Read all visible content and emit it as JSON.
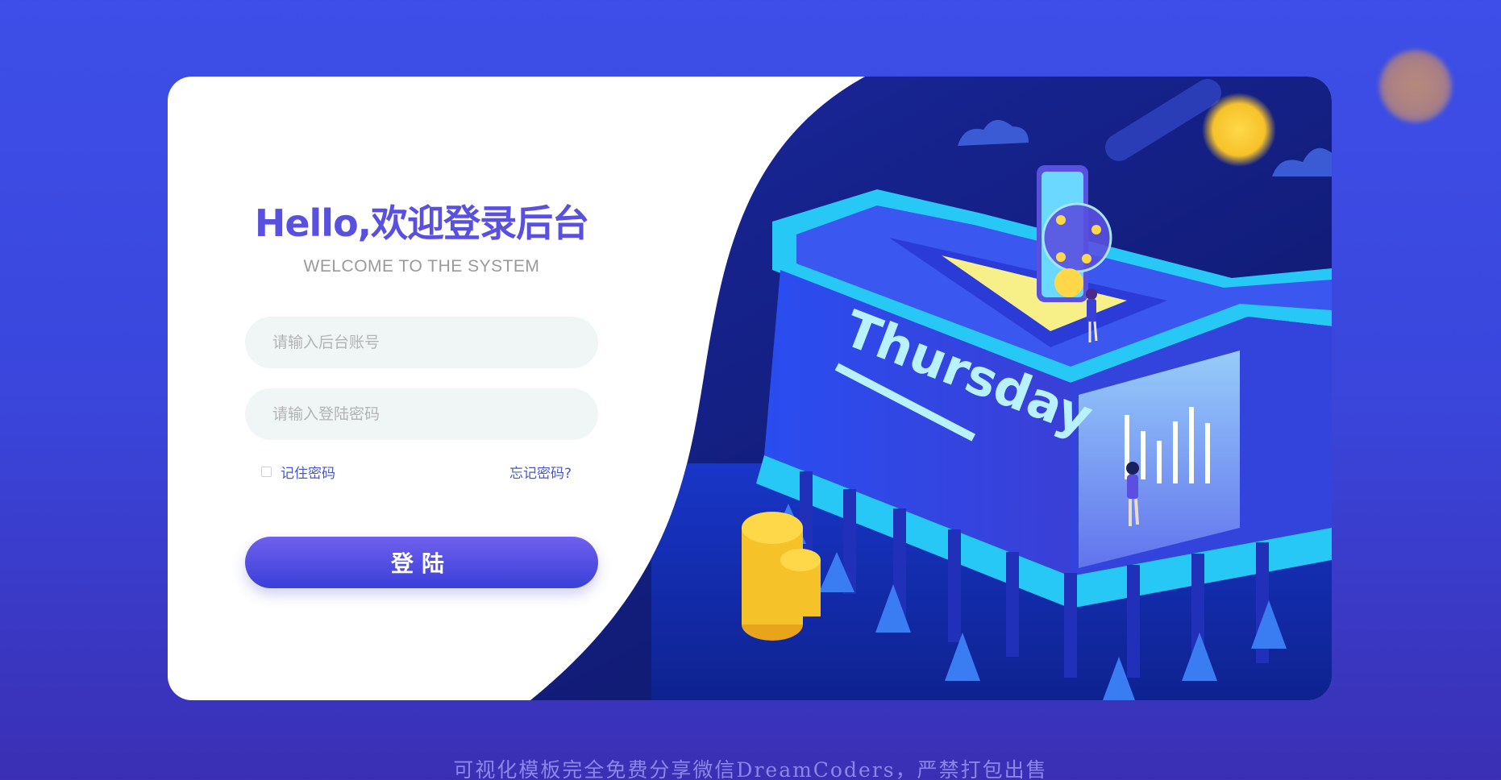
{
  "login": {
    "title": "Hello,欢迎登录后台",
    "subtitle": "WELCOME TO THE SYSTEM",
    "username_placeholder": "请输入后台账号",
    "password_placeholder": "请输入登陆密码",
    "remember_label": "记住密码",
    "forgot_label": "忘记密码?",
    "submit_label": "登陆"
  },
  "illustration": {
    "building_sign": "Thursday"
  },
  "footer": {
    "text": "可视化模板完全免费分享微信DreamCoders，严禁打包出售"
  },
  "colors": {
    "background": "#3d4fe8",
    "accent": "#5a50e0",
    "link": "#4a58c8",
    "input_bg": "#f0f5f5"
  }
}
